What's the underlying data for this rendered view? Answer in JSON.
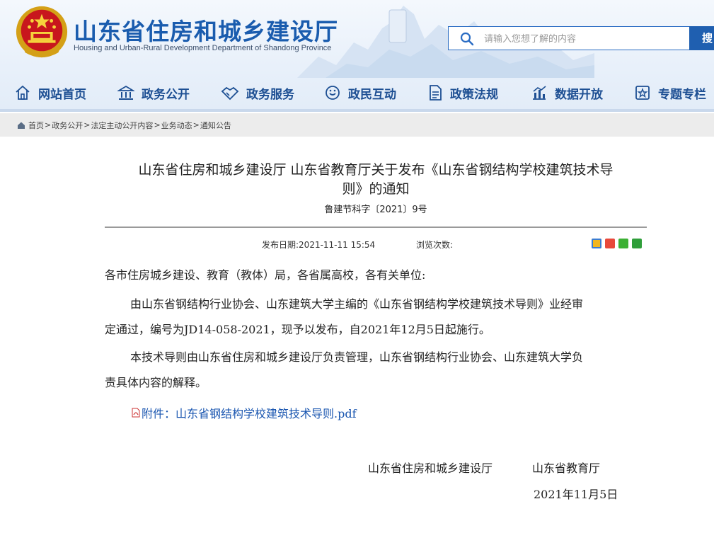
{
  "header": {
    "title": "山东省住房和城乡建设厅",
    "subtitle": "Housing and Urban-Rural Development Department of Shandong Province",
    "search": {
      "placeholder": "请输入您想了解的内容",
      "button": "搜"
    }
  },
  "nav": {
    "items": [
      {
        "label": "网站首页",
        "icon": "home-icon"
      },
      {
        "label": "政务公开",
        "icon": "government-building-icon"
      },
      {
        "label": "政务服务",
        "icon": "handshake-icon"
      },
      {
        "label": "政民互动",
        "icon": "interaction-icon"
      },
      {
        "label": "政策法规",
        "icon": "document-icon"
      },
      {
        "label": "数据开放",
        "icon": "chart-icon"
      },
      {
        "label": "专题专栏",
        "icon": "star-folder-icon"
      }
    ]
  },
  "breadcrumb": [
    "首页",
    "政务公开",
    "法定主动公开内容",
    "业务动态",
    "通知公告"
  ],
  "article": {
    "title_line1": "山东省住房和城乡建设厅 山东省教育厅关于发布《山东省钢结构学校建筑技术导",
    "title_line2": "则》的通知",
    "doc_number": "鲁建节科字〔2021〕9号",
    "publish_label": "发布日期:2021-11-11 15:54",
    "views_label": "浏览次数:",
    "share_icons": [
      "qzone-share-icon",
      "weibo-share-icon",
      "wechat-share-icon",
      "douban-share-icon"
    ],
    "salutation": "各市住房城乡建设、教育（教体）局，各省属高校，各有关单位:",
    "para1_line1": "由山东省钢结构行业协会、山东建筑大学主编的《山东省钢结构学校建筑技术导则》业经审",
    "para1_line2": "定通过，编号为JD14-058-2021，现予以发布，自2021年12月5日起施行。",
    "para2_line1": "本技术导则由山东省住房和城乡建设厅负责管理，山东省钢结构行业协会、山东建筑大学负",
    "para2_line2": "责具体内容的解释。",
    "attachment": "附件：山东省钢结构学校建筑技术导则.pdf",
    "signer1": "山东省住房和城乡建设厅",
    "signer2": "山东省教育厅",
    "date": "2021年11月5日"
  },
  "colors": {
    "brand": "#1a5cae",
    "nav_text": "#1d4f93",
    "link": "#1a56b0",
    "breadcrumb_bg": "#ececec"
  }
}
